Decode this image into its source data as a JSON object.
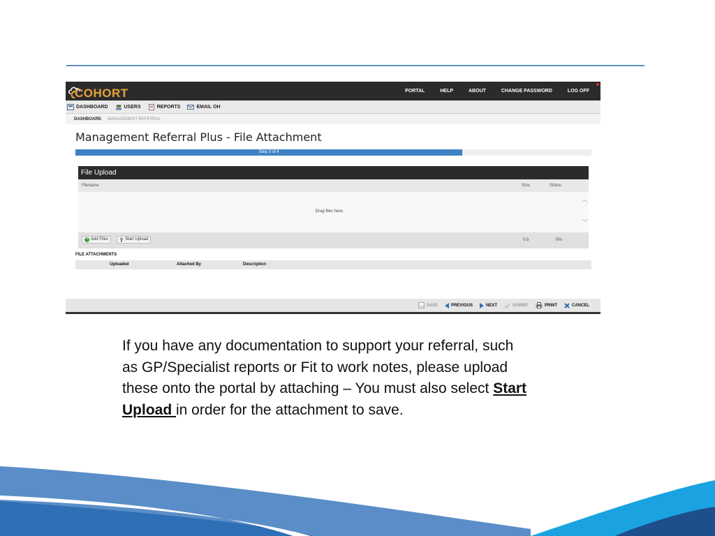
{
  "app": {
    "logo_text": "COHORT",
    "top_nav": [
      "PORTAL",
      "HELP",
      "ABOUT",
      "CHANGE PASSWORD",
      "LOG OFF"
    ]
  },
  "sub_nav": [
    {
      "label": "DASHBOARD",
      "icon": "dashboard-icon"
    },
    {
      "label": "USERS",
      "icon": "users-icon"
    },
    {
      "label": "REPORTS",
      "icon": "reports-icon"
    },
    {
      "label": "EMAIL OH",
      "icon": "email-icon"
    }
  ],
  "breadcrumb": {
    "current": "DASHBOARD",
    "next": "MANAGEMENT REFERRAL"
  },
  "page": {
    "title": "Management Referral Plus - File Attachment",
    "progress_label": "Step 3 of 4",
    "progress_fraction": 0.75
  },
  "file_upload": {
    "title": "File Upload",
    "columns": {
      "filename": "Filename",
      "size": "Size",
      "status": "Status"
    },
    "drop_text": "Drag files here.",
    "add_files_label": "Add Files",
    "start_upload_label": "Start Upload",
    "total_size": "0 b",
    "total_status": "0%"
  },
  "attachments": {
    "title": "FILE ATTACHMENTS",
    "columns": [
      "Uploaded",
      "Attached By",
      "Description"
    ]
  },
  "actions": [
    {
      "label": "SAVE",
      "icon": "save-icon",
      "enabled": false
    },
    {
      "label": "PREVIOUS",
      "icon": "previous-icon",
      "enabled": true
    },
    {
      "label": "NEXT",
      "icon": "next-icon",
      "enabled": true
    },
    {
      "label": "SUBMIT",
      "icon": "submit-icon",
      "enabled": false
    },
    {
      "label": "PRINT",
      "icon": "print-icon",
      "enabled": true
    },
    {
      "label": "CANCEL",
      "icon": "cancel-icon",
      "enabled": true
    }
  ],
  "caption": {
    "part1": "If you have any documentation to support your referral, such as GP/Specialist reports or Fit to work notes, please upload these onto the portal by attaching – You must also select ",
    "emphasis": "Start Upload ",
    "part2": "in order for the attachment to save."
  },
  "colors": {
    "accent_blue": "#3f82c4",
    "logo_orange": "#e8a13a",
    "dark_bar": "#2b2b2b",
    "wave_light": "#5b8ec8",
    "wave_mid": "#2e6fb5",
    "wave_dark": "#1f4e8c",
    "wave_cyan": "#1aa3e0"
  }
}
